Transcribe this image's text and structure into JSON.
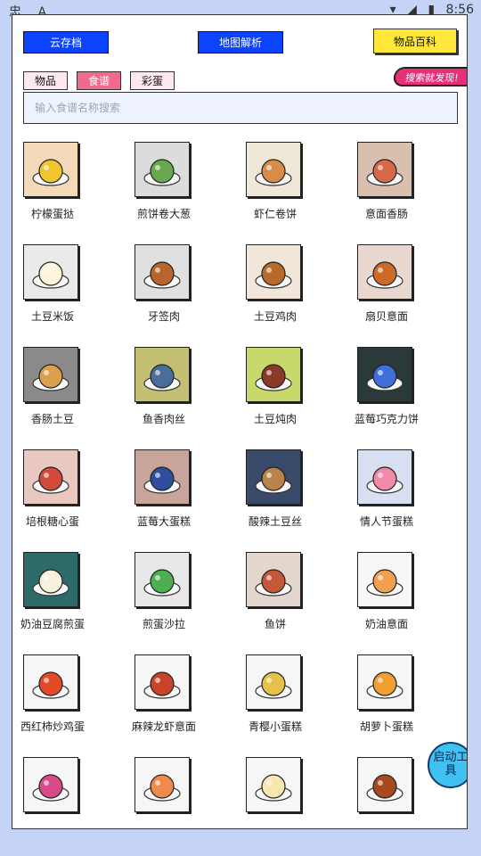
{
  "statusbar": {
    "left_icons": [
      "忠",
      "A"
    ],
    "time": "8:56"
  },
  "toolbar": {
    "cloud_save": "云存档",
    "map_parse": "地图解析",
    "wiki": "物品百科"
  },
  "tabs": [
    "物品",
    "食谱",
    "彩蛋"
  ],
  "active_tab": 1,
  "corner_badge": "搜索就发现!",
  "search": {
    "placeholder": "输入食谱名称搜索"
  },
  "recipes": [
    "柠檬蛋挞",
    "煎饼卷大葱",
    "虾仁卷饼",
    "意面香肠",
    "土豆米饭",
    "牙签肉",
    "土豆鸡肉",
    "扇贝意面",
    "香肠土豆",
    "鱼香肉丝",
    "土豆炖肉",
    "蓝莓巧克力饼",
    "培根糖心蛋",
    "蓝莓大蛋糕",
    "酸辣土豆丝",
    "情人节蛋糕",
    "奶油豆腐煎蛋",
    "煎蛋沙拉",
    "鱼饼",
    "奶油意面",
    "西红柿炒鸡蛋",
    "麻辣龙虾意面",
    "青樱小蛋糕",
    "胡萝卜蛋糕",
    "",
    "",
    "",
    ""
  ],
  "fab": "启动工具",
  "colors": {
    "accent_blue": "#0b43ff",
    "active_tab": "#f06a8c",
    "wiki_yellow": "#ffe83a",
    "fab": "#3fc1f1"
  }
}
